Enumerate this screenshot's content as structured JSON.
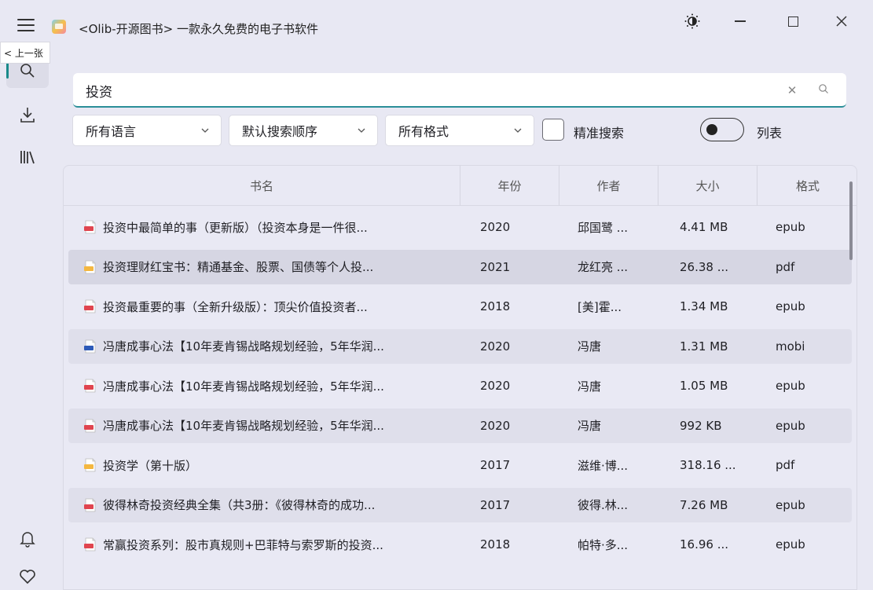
{
  "app": {
    "title": "<Olib-开源图书> 一款永久免费的电子书软件",
    "tooltip": "< 上一张"
  },
  "search": {
    "value": "投资",
    "placeholder": ""
  },
  "filters": {
    "language": "所有语言",
    "order": "默认搜索顺序",
    "format": "所有格式",
    "exact_label": "精准搜索",
    "list_label": "列表"
  },
  "table": {
    "headers": {
      "name": "书名",
      "year": "年份",
      "author": "作者",
      "size": "大小",
      "format": "格式"
    },
    "rows": [
      {
        "name": "投资中最简单的事（更新版）（投资本身是一件很...",
        "year": "2020",
        "author": "邱国鹭 ...",
        "size": "4.41 MB",
        "format": "epub"
      },
      {
        "name": "投资理财红宝书：精通基金、股票、国债等个人投...",
        "year": "2021",
        "author": "龙红亮 ...",
        "size": "26.38 ...",
        "format": "pdf"
      },
      {
        "name": "投资最重要的事（全新升级版）：顶尖价值投资者...",
        "year": "2018",
        "author": "[美]霍...",
        "size": "1.34 MB",
        "format": "epub"
      },
      {
        "name": "冯唐成事心法【10年麦肯锡战略规划经验，5年华润...",
        "year": "2020",
        "author": "冯唐",
        "size": "1.31 MB",
        "format": "mobi"
      },
      {
        "name": "冯唐成事心法【10年麦肯锡战略规划经验，5年华润...",
        "year": "2020",
        "author": "冯唐",
        "size": "1.05 MB",
        "format": "epub"
      },
      {
        "name": "冯唐成事心法【10年麦肯锡战略规划经验，5年华润...",
        "year": "2020",
        "author": "冯唐",
        "size": "992 KB",
        "format": "epub"
      },
      {
        "name": "投资学（第十版）",
        "year": "2017",
        "author": "滋维·博...",
        "size": "318.16 ...",
        "format": "pdf"
      },
      {
        "name": "彼得林奇投资经典全集（共3册：《彼得林奇的成功...",
        "year": "2017",
        "author": "彼得.林...",
        "size": "7.26 MB",
        "format": "epub"
      },
      {
        "name": "常赢投资系列：股市真规则+巴菲特与索罗斯的投资...",
        "year": "2018",
        "author": "帕特·多...",
        "size": "16.96 ...",
        "format": "epub"
      }
    ]
  },
  "colors": {
    "accent": "#2a8f98",
    "epub": "#e0454f",
    "pdf": "#f4b740",
    "mobi": "#2e5bb8"
  }
}
